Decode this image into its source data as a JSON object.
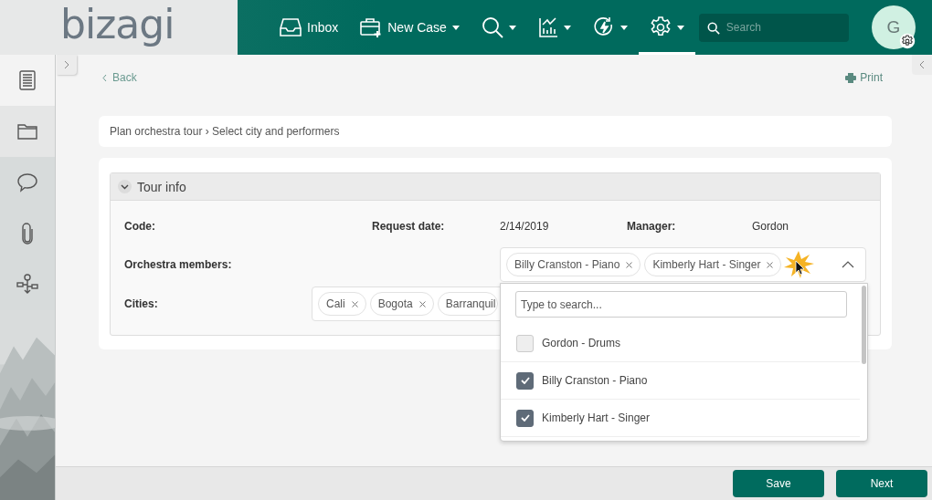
{
  "header": {
    "logo": "bizagi",
    "nav": [
      {
        "kind": "inbox",
        "label": "Inbox",
        "dropdown": false,
        "selected": false
      },
      {
        "kind": "new-case",
        "label": "New Case",
        "dropdown": true,
        "selected": false
      },
      {
        "kind": "search",
        "dropdown": true,
        "selected": false
      },
      {
        "kind": "analytics",
        "dropdown": true,
        "selected": false
      },
      {
        "kind": "refresh",
        "dropdown": true,
        "selected": false
      },
      {
        "kind": "settings",
        "dropdown": true,
        "selected": true
      }
    ],
    "search": {
      "placeholder": "Search"
    },
    "avatar": {
      "initial": "G"
    }
  },
  "sidebar": {
    "items": [
      {
        "kind": "form",
        "selected": true
      },
      {
        "kind": "folder",
        "selected": false
      },
      {
        "kind": "comment",
        "selected": false
      },
      {
        "kind": "attachment",
        "selected": false
      },
      {
        "kind": "workflow",
        "selected": false
      }
    ]
  },
  "toolbar": {
    "back": "Back",
    "print": "Print"
  },
  "breadcrumb": "Plan orchestra tour › Select city and performers",
  "section": {
    "title": "Tour info",
    "expanded": true,
    "code_label": "Code:",
    "request_date_label": "Request date:",
    "request_date": "2/14/2019",
    "manager_label": "Manager:",
    "manager": "Gordon",
    "members": {
      "label": "Orchestra members:",
      "tags": [
        {
          "label": "Billy Cranston - Piano",
          "removable": true
        },
        {
          "label": "Kimberly Hart - Singer",
          "removable": true
        }
      ],
      "expanded": true,
      "dropdown": {
        "placeholder": "Type to search...",
        "options": [
          {
            "label": "Gordon - Drums",
            "checked": false
          },
          {
            "label": "Billy Cranston - Piano",
            "checked": true
          },
          {
            "label": "Kimberly Hart - Singer",
            "checked": true
          }
        ]
      }
    },
    "cities": {
      "label": "Cities:",
      "tags": [
        {
          "label": "Cali",
          "removable": true
        },
        {
          "label": "Bogota",
          "removable": true
        },
        {
          "label": "Barranquil",
          "removable": false
        }
      ]
    }
  },
  "buttons": [
    {
      "label": "Save"
    },
    {
      "label": "Next"
    }
  ]
}
